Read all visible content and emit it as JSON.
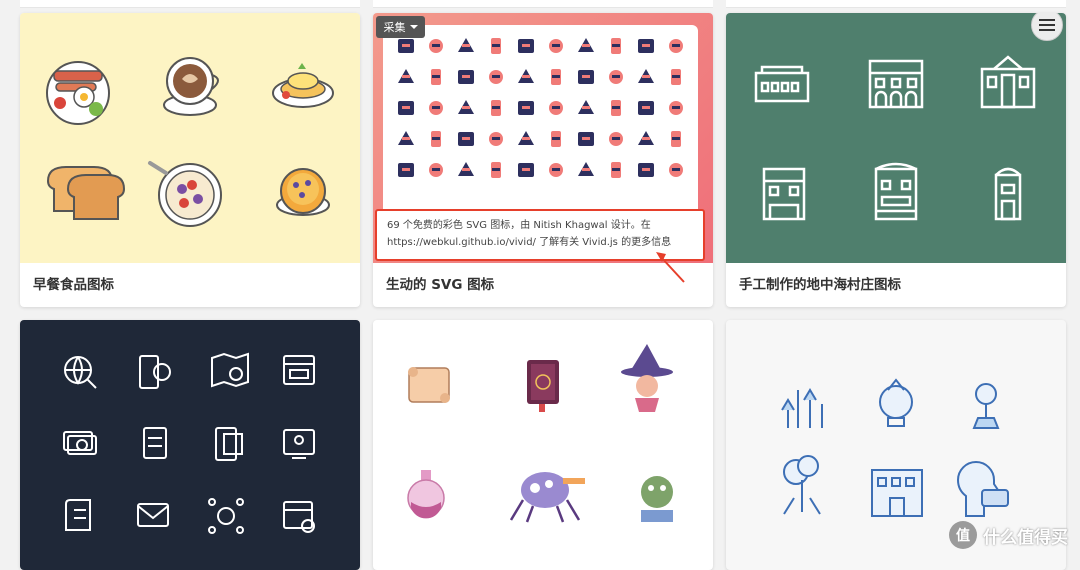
{
  "cards": {
    "breakfast": {
      "caption": "早餐食品图标",
      "bg": "#fdf4c4"
    },
    "vivid": {
      "caption": "生动的 SVG 图标",
      "bg": "#f07b78"
    },
    "mediterranean": {
      "caption": "手工制作的地中海村庄图标",
      "bg": "#4f7f6d"
    },
    "dark_icons": {
      "bg": "#1f2838"
    },
    "fantasy": {
      "bg": "#ffffff"
    },
    "education": {
      "bg": "#f7f7f7"
    }
  },
  "collect_button": {
    "label": "采集"
  },
  "vivid_description": {
    "line1": "69 个免费的彩色 SVG 图标，由 Nitish Khagwal 设计。在",
    "line2": "https://webkul.github.io/vivid/ 了解有关 Vivid.js 的更多信息"
  },
  "watermark": {
    "logo": "值",
    "text": "什么值得买"
  },
  "colors": {
    "accent_red": "#e63f2b",
    "navy": "#2d2f5e",
    "coral": "#f07b78"
  }
}
